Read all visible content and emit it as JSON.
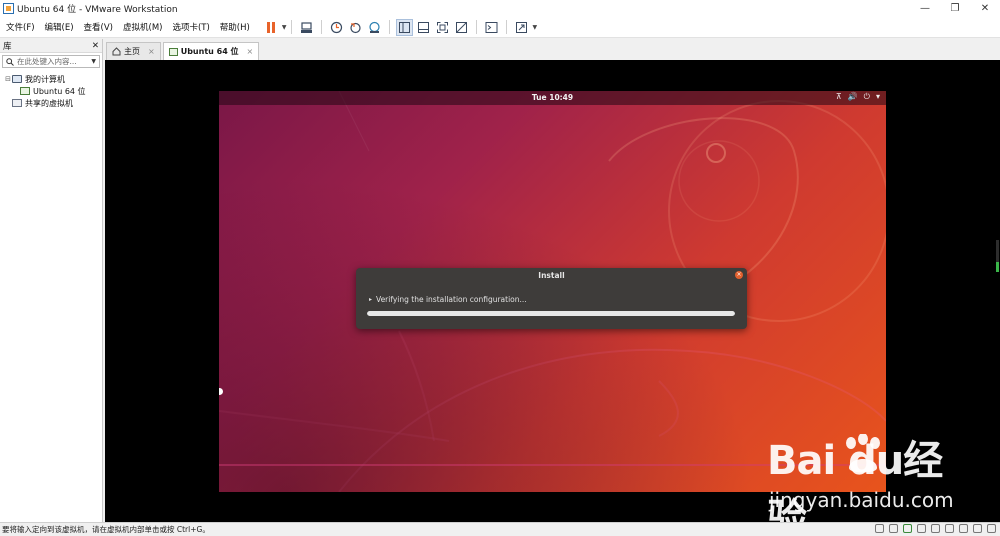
{
  "window": {
    "title": "Ubuntu 64 位 - VMware Workstation",
    "minimize_glyph": "—",
    "restore_glyph": "❐",
    "close_glyph": "✕"
  },
  "menu": [
    "文件(F)",
    "编辑(E)",
    "查看(V)",
    "虚拟机(M)",
    "选项卡(T)",
    "帮助(H)"
  ],
  "toolbar": {
    "accent": "#e8632a",
    "icons": [
      "pause-icon",
      "send-ctrl-alt-del-icon",
      "snapshot-icon",
      "revert-snapshot-icon",
      "snapshot-manager-icon",
      "library-view-icon",
      "thumbnail-view-icon",
      "fullscreen-icon",
      "unity-icon",
      "console-icon",
      "stretch-icon"
    ]
  },
  "library": {
    "title": "库",
    "close_glyph": "✕",
    "search_placeholder": "在此处键入内容...",
    "tree": [
      {
        "label": "我的计算机",
        "level": 0,
        "expander": "⊟"
      },
      {
        "label": "Ubuntu 64 位",
        "level": 1,
        "expander": ""
      },
      {
        "label": "共享的虚拟机",
        "level": 0,
        "expander": ""
      }
    ]
  },
  "tabs": [
    {
      "label": "主页",
      "active": false
    },
    {
      "label": "Ubuntu 64 位",
      "active": true
    }
  ],
  "tab_close_glyph": "×",
  "guest": {
    "clock": "Tue 10:49",
    "tray": [
      "⊼",
      "🔊",
      "⏻",
      "▾"
    ],
    "dialog": {
      "title": "Install",
      "close_glyph": "×",
      "status_arrow": "▸",
      "status": "Verifying the installation configuration...",
      "progress": 1.0
    }
  },
  "watermark": {
    "logo": "Bai  du经验",
    "url": "jingyan.baidu.com"
  },
  "statusbar": {
    "text": "要将输入定向到该虚拟机，请在虚拟机内部单击或按 Ctrl+G。"
  }
}
